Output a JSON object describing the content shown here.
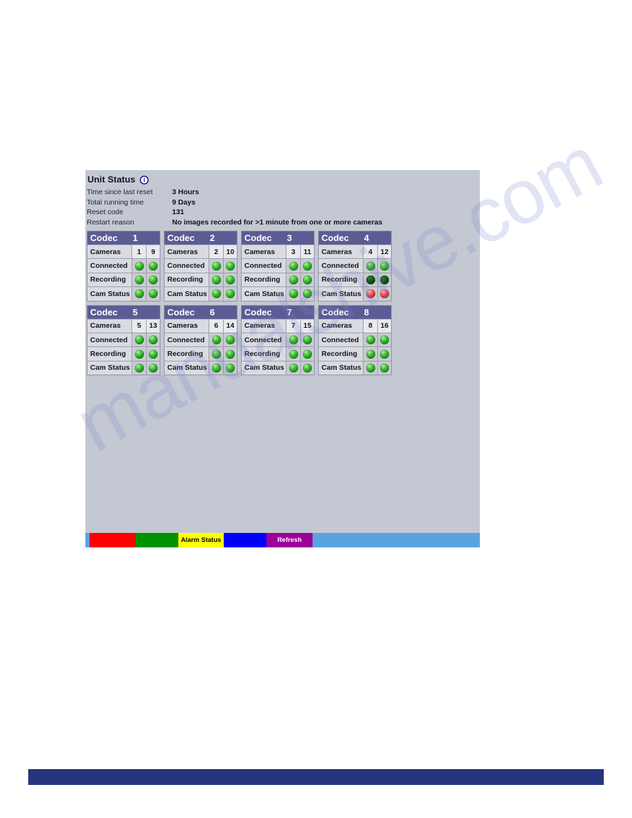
{
  "page": {
    "title": "Unit Status",
    "info_icon": "info-circle-icon",
    "watermark": "manualshive.com"
  },
  "summary": {
    "rows": [
      {
        "label": "Time since last reset",
        "value": "3 Hours"
      },
      {
        "label": "Total running time",
        "value": "9 Days"
      },
      {
        "label": "Reset code",
        "value": "131"
      },
      {
        "label": "Restart reason",
        "value": "No images recorded for >1 minute from one or more cameras"
      }
    ]
  },
  "codec_table": {
    "row_labels": [
      "Cameras",
      "Connected",
      "Recording",
      "Cam Status"
    ],
    "head_label": "Codec",
    "codecs": [
      {
        "number": "1",
        "cameras": [
          "1",
          "9"
        ],
        "connected": [
          "green",
          "green"
        ],
        "recording": [
          "green",
          "green"
        ],
        "cam_status": [
          "green",
          "green"
        ]
      },
      {
        "number": "2",
        "cameras": [
          "2",
          "10"
        ],
        "connected": [
          "green",
          "green"
        ],
        "recording": [
          "green",
          "green"
        ],
        "cam_status": [
          "green",
          "green"
        ]
      },
      {
        "number": "3",
        "cameras": [
          "3",
          "11"
        ],
        "connected": [
          "green",
          "green"
        ],
        "recording": [
          "green",
          "green"
        ],
        "cam_status": [
          "green",
          "green"
        ]
      },
      {
        "number": "4",
        "cameras": [
          "4",
          "12"
        ],
        "connected": [
          "green",
          "green"
        ],
        "recording": [
          "darkgreen",
          "darkgreen"
        ],
        "cam_status": [
          "red",
          "red"
        ]
      },
      {
        "number": "5",
        "cameras": [
          "5",
          "13"
        ],
        "connected": [
          "green",
          "green"
        ],
        "recording": [
          "green",
          "green"
        ],
        "cam_status": [
          "green",
          "green"
        ]
      },
      {
        "number": "6",
        "cameras": [
          "6",
          "14"
        ],
        "connected": [
          "green",
          "green"
        ],
        "recording": [
          "green",
          "green"
        ],
        "cam_status": [
          "green",
          "green"
        ]
      },
      {
        "number": "7",
        "cameras": [
          "7",
          "15"
        ],
        "connected": [
          "green",
          "green"
        ],
        "recording": [
          "green",
          "green"
        ],
        "cam_status": [
          "green",
          "green"
        ]
      },
      {
        "number": "8",
        "cameras": [
          "8",
          "16"
        ],
        "connected": [
          "green",
          "green"
        ],
        "recording": [
          "green",
          "green"
        ],
        "cam_status": [
          "green",
          "green"
        ]
      }
    ]
  },
  "button_bar": {
    "buttons": [
      {
        "label": "",
        "color": "#fd0000",
        "name": "red-button"
      },
      {
        "label": "",
        "color": "#009200",
        "name": "green-button"
      },
      {
        "label": "Alarm Status",
        "color": "#ffff00",
        "name": "alarm-status-button"
      },
      {
        "label": "",
        "color": "#0000ff",
        "name": "blue-button"
      },
      {
        "label": "Refresh",
        "color": "#9d0099",
        "name": "refresh-button"
      }
    ]
  },
  "colors": {
    "panel_background": "#c3c8d2",
    "header_purple": "#5c5c95",
    "bar_blue": "#5ba3e0",
    "footer_blue": "#27357f"
  }
}
